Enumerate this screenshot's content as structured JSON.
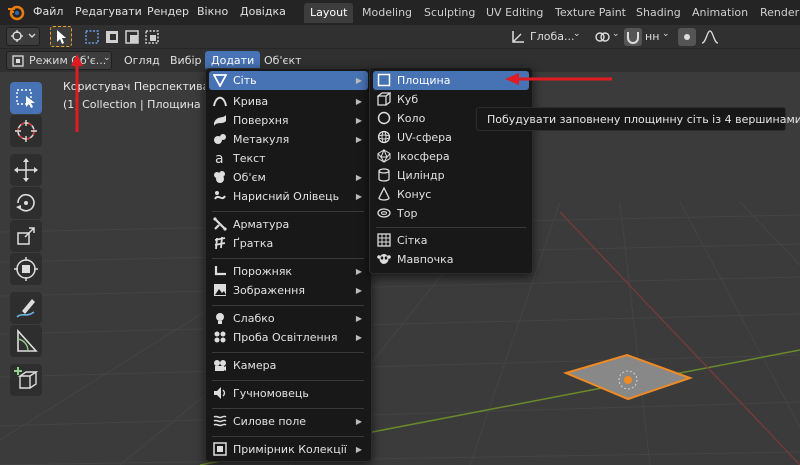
{
  "topbar": {
    "menus": [
      "Файл",
      "Редагувати",
      "Рендер",
      "Вікно",
      "Довідка"
    ],
    "workspace_tabs": [
      "Layout",
      "Modeling",
      "Sculpting",
      "UV Editing",
      "Texture Paint",
      "Shading",
      "Animation",
      "Renderi"
    ],
    "active_tab": "Layout"
  },
  "toolheader": {
    "transform_orientation": "Глоба...",
    "proportional_mode": "нн"
  },
  "viewport_header": {
    "mode": "Режим Об'є...",
    "menus": [
      "Огляд",
      "Вибір",
      "Додати",
      "Об'єкт"
    ],
    "active_menu": "Додати"
  },
  "viewport": {
    "view_name": "Користувач Перспектива",
    "collection_info": "(1) Collection | Площина"
  },
  "add_menu": {
    "items": [
      {
        "label": "Сіть",
        "icon": "mesh-icon",
        "submenu": true
      },
      {
        "label": "Крива",
        "icon": "curve-icon",
        "submenu": true
      },
      {
        "label": "Поверхня",
        "icon": "surface-icon",
        "submenu": true
      },
      {
        "label": "Метакуля",
        "icon": "metaball-icon",
        "submenu": true
      },
      {
        "label": "Текст",
        "icon": "text-icon",
        "submenu": false
      },
      {
        "label": "Об'єм",
        "icon": "volume-icon",
        "submenu": true
      },
      {
        "label": "Нарисний Олівець",
        "icon": "grease-pencil-icon",
        "submenu": true
      },
      {
        "label": "Арматура",
        "icon": "armature-icon",
        "submenu": false
      },
      {
        "label": "Ґратка",
        "icon": "lattice-icon",
        "submenu": false
      },
      {
        "label": "Порожняк",
        "icon": "empty-icon",
        "submenu": true
      },
      {
        "label": "Зображення",
        "icon": "image-icon",
        "submenu": true
      },
      {
        "label": "Слабко",
        "icon": "light-icon",
        "submenu": true
      },
      {
        "label": "Проба Освітлення",
        "icon": "light-probe-icon",
        "submenu": true
      },
      {
        "label": "Камера",
        "icon": "camera-icon",
        "submenu": false
      },
      {
        "label": "Гучномовець",
        "icon": "speaker-icon",
        "submenu": false
      },
      {
        "label": "Силове поле",
        "icon": "force-field-icon",
        "submenu": true
      },
      {
        "label": "Примірник Колекції",
        "icon": "collection-instance-icon",
        "submenu": true
      }
    ]
  },
  "mesh_menu": {
    "items": [
      {
        "label": "Площина",
        "icon": "plane-icon"
      },
      {
        "label": "Куб",
        "icon": "cube-icon"
      },
      {
        "label": "Коло",
        "icon": "circle-icon"
      },
      {
        "label": "UV-сфера",
        "icon": "uv-sphere-icon"
      },
      {
        "label": "Ікосфера",
        "icon": "icosphere-icon"
      },
      {
        "label": "Циліндр",
        "icon": "cylinder-icon"
      },
      {
        "label": "Конус",
        "icon": "cone-icon"
      },
      {
        "label": "Тор",
        "icon": "torus-icon"
      },
      {
        "label": "Сітка",
        "icon": "grid-icon"
      },
      {
        "label": "Мавпочка",
        "icon": "monkey-icon"
      }
    ]
  },
  "tooltip": "Побудувати заповнену площинну сіть із 4 вершинами.",
  "colors": {
    "accent": "#4772b3",
    "annotation_arrow": "#e01b22",
    "selection_outline": "#f08a24",
    "x_axis": "#7d3a3a",
    "y_axis": "#6a8a2a"
  }
}
